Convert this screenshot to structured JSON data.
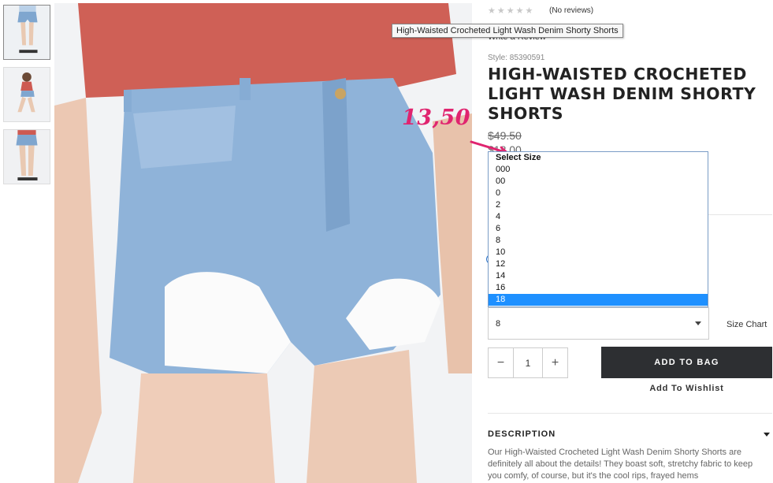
{
  "rating": {
    "stars": "★★★★★",
    "reviews": "(No reviews)",
    "write_review": "Write a Review"
  },
  "tooltip": "High-Waisted Crocheted Light Wash Denim Shorty Shorts",
  "product": {
    "style": "Style: 85390591",
    "title": "HIGH-WAISTED CROCHETED LIGHT WASH DENIM SHORTY SHORTS",
    "price_old": "$49.50",
    "price_new": "$18.00"
  },
  "annotation": "13,50",
  "size_options": [
    "Select Size",
    "000",
    "00",
    "0",
    "2",
    "4",
    "6",
    "8",
    "10",
    "12",
    "14",
    "16",
    "18"
  ],
  "size_select": {
    "value": "8",
    "size_chart": "Size Chart"
  },
  "quantity": {
    "decrement": "−",
    "value": "1",
    "increment": "+"
  },
  "actions": {
    "add_to_bag": "ADD TO BAG",
    "wishlist": "Add To Wishlist"
  },
  "description": {
    "title": "DESCRIPTION",
    "text": "Our High-Waisted Crocheted Light Wash Denim Shorty Shorts are definitely all about the details! They boast soft, stretchy fabric to keep you comfy, of course, but it's the cool rips, frayed hems"
  },
  "colors": {
    "accent_blue": "#1e90ff",
    "button_dark": "#2d2f32",
    "annotation_pink": "#e0246f"
  }
}
